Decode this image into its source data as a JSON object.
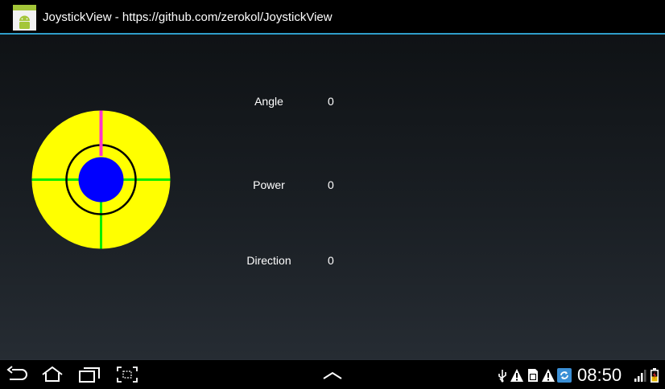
{
  "titlebar": {
    "title": "JoystickView - https://github.com/zerokol/JoystickView",
    "app_icon": "android-app-icon"
  },
  "readouts": {
    "angle_label": "Angle",
    "angle_value": "0",
    "power_label": "Power",
    "power_value": "0",
    "direction_label": "Direction",
    "direction_value": "0"
  },
  "joystick": {
    "angle": 0,
    "power": 0,
    "colors": {
      "outer": "#ffff00",
      "handle": "#0000ff",
      "crosshair": "#00ee00",
      "direction_line": "#ff33cc",
      "ring": "#000000"
    }
  },
  "navbar": {
    "buttons": [
      "back-icon",
      "home-icon",
      "recent-apps-icon",
      "screenshot-icon"
    ],
    "menu_icon": "chevron-up-icon",
    "status_icons": [
      "usb-icon",
      "warning-icon",
      "sd-card-icon",
      "warning-icon",
      "sync-icon"
    ],
    "clock": "08:50",
    "signal_icon": "signal-icon",
    "battery_icon": "battery-icon"
  },
  "colors": {
    "accent": "#2f9cc8",
    "background_top": "#0f1215",
    "background_bottom": "#262c33"
  }
}
